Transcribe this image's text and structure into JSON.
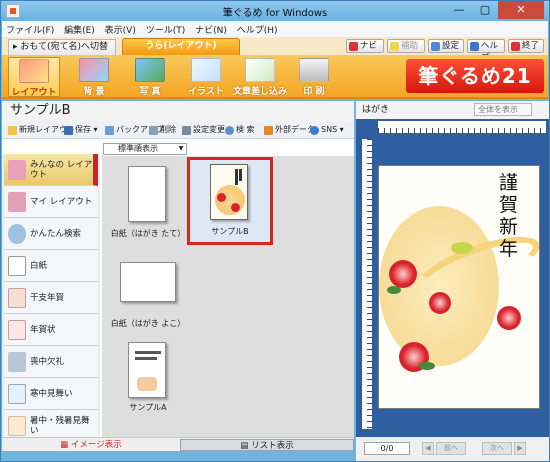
{
  "window": {
    "title": "筆ぐるめ for Windows",
    "min": "—",
    "max": "▢",
    "close": "✕"
  },
  "menu": [
    "ファイル(F)",
    "編集(E)",
    "表示(V)",
    "ツール(T)",
    "ナビ(N)",
    "ヘルプ(H)"
  ],
  "tabs": {
    "front": "▸ おもて(宛て名)へ切替",
    "back": "うら(レイアウト)"
  },
  "toolbuttons": {
    "navi": "ナビ",
    "hojo": "補助",
    "settings": "設定",
    "help": "ヘルプ",
    "exit": "終了"
  },
  "ribbon": [
    "レイアウト",
    "背 景",
    "写 真",
    "イラスト",
    "文章差し込み",
    "印 刷"
  ],
  "logo": "筆ぐるめ21",
  "panel": {
    "title": "サンプルB"
  },
  "toolbar": [
    "新規レイアウト",
    "保存 ▾",
    "バックアップ",
    "削除",
    "設定変更",
    "検 索",
    "外部データ",
    "SNS ▾"
  ],
  "categories": [
    "みんなの レイアウト",
    "マイ レイアウト",
    "かんたん検索",
    "白紙",
    "干支年賀",
    "年賀状",
    "喪中欠礼",
    "寒中見舞い",
    "暑中・残暑見舞い"
  ],
  "sort": {
    "value": "標準順表示"
  },
  "thumbs": {
    "blank_tate": "白紙（はがき たて）",
    "sample_b": "サンプルB",
    "blank_yoko": "白紙（はがき よこ）",
    "sample_a": "サンプルA"
  },
  "footer": {
    "image_view": "イメージ表示",
    "list_view": "リスト表示"
  },
  "preview": {
    "title": "はがき",
    "zoom_placeholder": "全体を表示",
    "greeting": "謹賀新年",
    "page": "0/0",
    "prev": "前へ",
    "next": "次へ"
  },
  "colors": {
    "ribbon": "#f5a623",
    "accent": "#d9261c",
    "frame": "#6fb3e0"
  }
}
